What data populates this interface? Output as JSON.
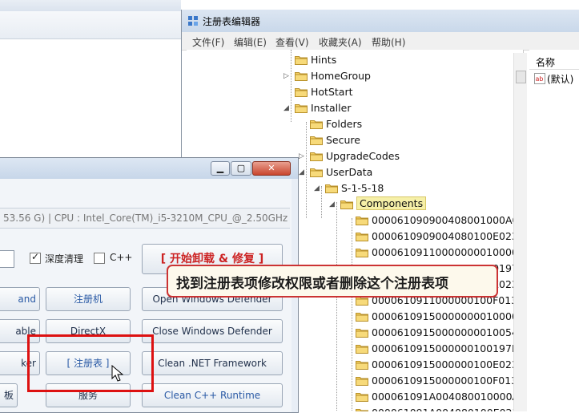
{
  "regedit": {
    "title": "注册表编辑器",
    "menu": [
      "文件(F)",
      "编辑(E)",
      "查看(V)",
      "收藏夹(A)",
      "帮助(H)"
    ],
    "tree": [
      {
        "label": "Hints",
        "level": 0,
        "expander": ""
      },
      {
        "label": "HomeGroup",
        "level": 0,
        "expander": "▷"
      },
      {
        "label": "HotStart",
        "level": 0,
        "expander": ""
      },
      {
        "label": "Installer",
        "level": 0,
        "expander": "◢"
      },
      {
        "label": "Folders",
        "level": 1,
        "expander": ""
      },
      {
        "label": "Secure",
        "level": 1,
        "expander": ""
      },
      {
        "label": "UpgradeCodes",
        "level": 1,
        "expander": "▷"
      },
      {
        "label": "UserData",
        "level": 1,
        "expander": "◢"
      },
      {
        "label": "S-1-5-18",
        "level": 2,
        "expander": "◢"
      },
      {
        "label": "Components",
        "level": 3,
        "expander": "◢",
        "selected": true
      },
      {
        "label": "000061090900408001000A0I",
        "level": 4,
        "expander": ""
      },
      {
        "label": "0000610909004080100E0239",
        "level": 4,
        "expander": ""
      },
      {
        "label": "00006109110000000010000A0I",
        "level": 4,
        "expander": ""
      },
      {
        "label": "00006109110000000100197D:",
        "level": 4,
        "expander": ""
      },
      {
        "label": "0000610911000000100E0239",
        "level": 4,
        "expander": ""
      },
      {
        "label": "0000610911000000100F013E",
        "level": 4,
        "expander": ""
      },
      {
        "label": "00006109150000000010000A0I",
        "level": 4,
        "expander": ""
      },
      {
        "label": "000061091500000000100540F",
        "level": 4,
        "expander": ""
      },
      {
        "label": "0000610915000000100197D:",
        "level": 4,
        "expander": ""
      },
      {
        "label": "0000610915000000100E0239",
        "level": 4,
        "expander": ""
      },
      {
        "label": "0000610915000000100F013E",
        "level": 4,
        "expander": ""
      },
      {
        "label": "000061091A004080010000A0I",
        "level": 4,
        "expander": ""
      },
      {
        "label": "000061091A004080100E0239",
        "level": 4,
        "expander": ""
      }
    ],
    "values_header": "名称",
    "value_default": "(默认)"
  },
  "tool": {
    "info_text": "53.56 G) | CPU : Intel_Core(TM)_i5-3210M_CPU_@_2.50GHz",
    "deep_clean_label": "深度清理",
    "cpp_label": "C++",
    "start_button": "[ 开始卸载 & 修复 ]",
    "buttons": {
      "and": "and",
      "register_machine": "注册机",
      "open_defender": "Open Windows Defender",
      "able": "able",
      "directx": "DirectX",
      "close_defender": "Close Windows Defender",
      "ker": "ker",
      "registry": "[ 注册表 ]",
      "clean_net": "Clean .NET Framework",
      "board": "板",
      "service": "服务",
      "clean_cpp": "Clean C++ Runtime"
    }
  },
  "annotation": {
    "text": "找到注册表项修改权限或者删除这个注册表项"
  },
  "colors": {
    "highlight_red": "#dd1111",
    "start_button_text": "#cc2222",
    "selection": "#f6f0a8"
  }
}
